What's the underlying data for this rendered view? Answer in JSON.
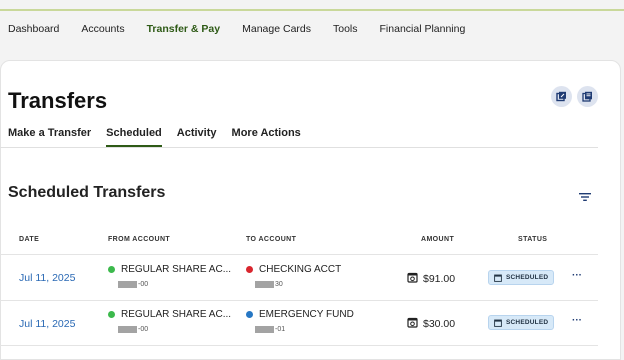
{
  "top_nav": [
    "Dashboard",
    "Accounts",
    "Transfer & Pay",
    "Manage Cards",
    "Tools",
    "Financial Planning"
  ],
  "active_nav": "Transfer & Pay",
  "page_title": "Transfers",
  "tabs": [
    "Make a Transfer",
    "Scheduled",
    "Activity",
    "More Actions"
  ],
  "active_tab": "Scheduled",
  "section_title": "Scheduled Transfers",
  "table": {
    "headers": {
      "date": "DATE",
      "from": "FROM ACCOUNT",
      "to": "TO ACCOUNT",
      "amount": "AMOUNT",
      "status": "STATUS"
    },
    "rows": [
      {
        "date": "Jul 11, 2025",
        "from_name": "REGULAR SHARE AC...",
        "from_suffix": "-00",
        "from_color": "#3cb94c",
        "to_name": "CHECKING ACCT",
        "to_suffix": "30",
        "to_color": "#d9262e",
        "amount": "$91.00",
        "status": "SCHEDULED",
        "more": "···"
      },
      {
        "date": "Jul 11, 2025",
        "from_name": "REGULAR SHARE AC...",
        "from_suffix": "-00",
        "from_color": "#3cb94c",
        "to_name": "EMERGENCY FUND",
        "to_suffix": "-01",
        "to_color": "#2677c4",
        "amount": "$30.00",
        "status": "SCHEDULED",
        "more": "···"
      }
    ]
  },
  "colors": {
    "brand_green": "#2e5a16",
    "link_blue": "#2a69b4",
    "status_bg": "#d7e9f8"
  }
}
